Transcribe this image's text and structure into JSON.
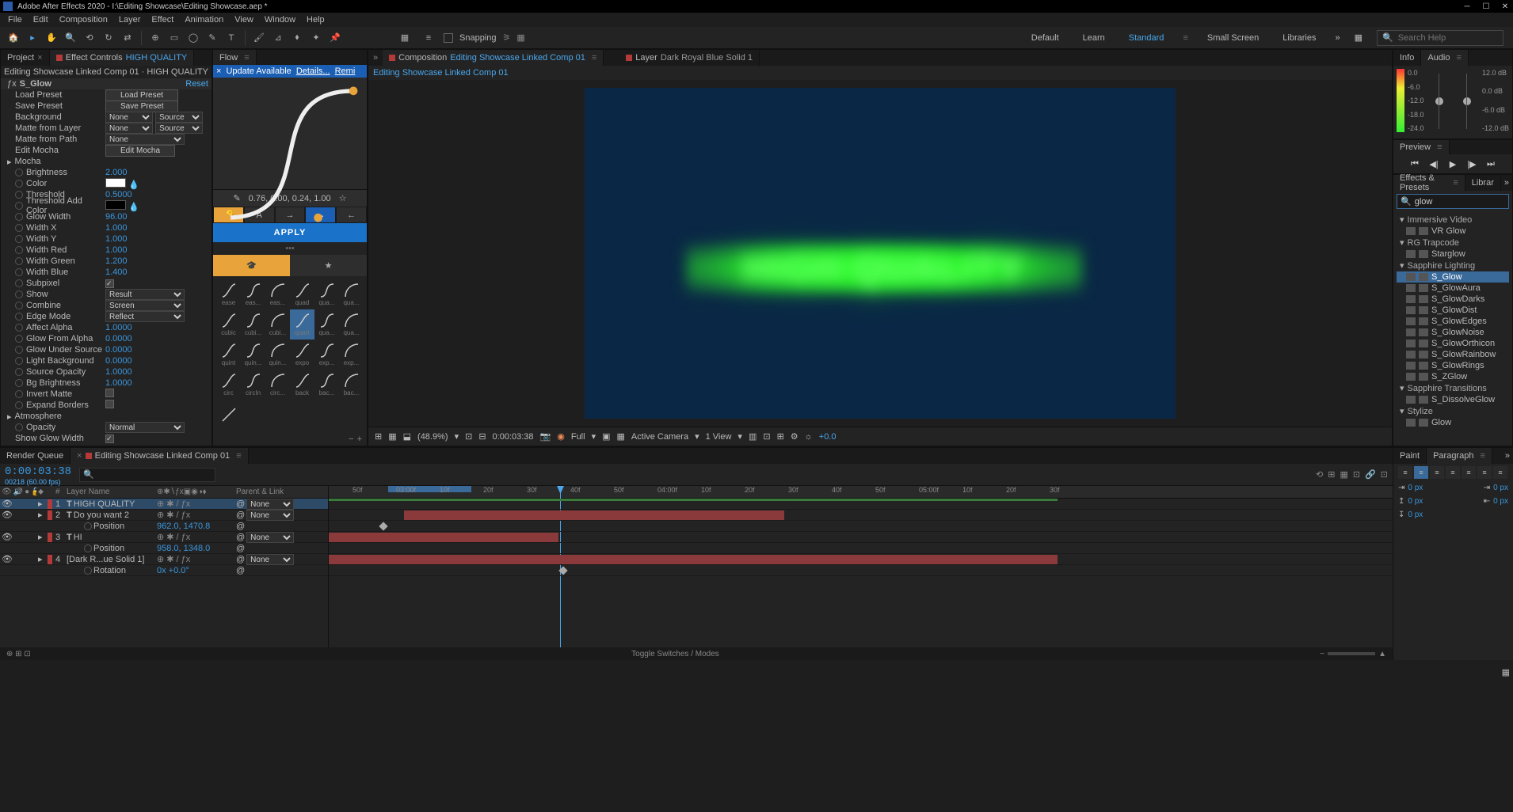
{
  "title": "Adobe After Effects 2020 - I:\\Editing Showcase\\Editing Showcase.aep *",
  "menu": [
    "File",
    "Edit",
    "Composition",
    "Layer",
    "Effect",
    "Animation",
    "View",
    "Window",
    "Help"
  ],
  "toolbar": {
    "snapping_label": "Snapping"
  },
  "workspaces": [
    "Default",
    "Learn",
    "Standard",
    "Small Screen",
    "Libraries"
  ],
  "workspace_active": "Standard",
  "search_placeholder": "Search Help",
  "leftPanel": {
    "tabs": [
      "Project",
      "Effect Controls"
    ],
    "active_effect_layer": "HIGH QUALITY",
    "breadcrumb": "Editing Showcase Linked Comp 01 · HIGH QUALITY",
    "effect_name": "S_Glow",
    "reset": "Reset",
    "props": [
      {
        "label": "Load Preset",
        "type": "btn",
        "btn": "Load Preset"
      },
      {
        "label": "Save Preset",
        "type": "btn",
        "btn": "Save Preset"
      },
      {
        "label": "Background",
        "type": "sel2",
        "v1": "None",
        "v2": "Source"
      },
      {
        "label": "Matte from Layer",
        "type": "sel2",
        "v1": "None",
        "v2": "Source"
      },
      {
        "label": "Matte from Path",
        "type": "sel",
        "v": "None"
      },
      {
        "label": "Edit Mocha",
        "type": "btn",
        "btn": "Edit Mocha"
      },
      {
        "label": "Mocha",
        "type": "group"
      },
      {
        "label": "Brightness",
        "type": "num",
        "v": "2.000",
        "sw": true
      },
      {
        "label": "Color",
        "type": "color",
        "v": "white",
        "sw": true
      },
      {
        "label": "Threshold",
        "type": "num",
        "v": "0.5000",
        "sw": true
      },
      {
        "label": "Threshold Add Color",
        "type": "color",
        "v": "black",
        "sw": true
      },
      {
        "label": "Glow Width",
        "type": "num",
        "v": "96.00",
        "sw": true
      },
      {
        "label": "Width X",
        "type": "num",
        "v": "1.000",
        "sw": true
      },
      {
        "label": "Width Y",
        "type": "num",
        "v": "1.000",
        "sw": true
      },
      {
        "label": "Width Red",
        "type": "num",
        "v": "1.000",
        "sw": true
      },
      {
        "label": "Width Green",
        "type": "num",
        "v": "1.200",
        "sw": true
      },
      {
        "label": "Width Blue",
        "type": "num",
        "v": "1.400",
        "sw": true
      },
      {
        "label": "Subpixel",
        "type": "check",
        "v": true,
        "sw": true
      },
      {
        "label": "Show",
        "type": "selw",
        "v": "Result",
        "sw": true
      },
      {
        "label": "Combine",
        "type": "selw",
        "v": "Screen",
        "sw": true
      },
      {
        "label": "Edge Mode",
        "type": "selw",
        "v": "Reflect",
        "sw": true
      },
      {
        "label": "Affect Alpha",
        "type": "num",
        "v": "1.0000",
        "sw": true
      },
      {
        "label": "Glow From Alpha",
        "type": "num",
        "v": "0.0000",
        "sw": true
      },
      {
        "label": "Glow Under Source",
        "type": "num",
        "v": "0.0000",
        "sw": true
      },
      {
        "label": "Light Background",
        "type": "num",
        "v": "0.0000",
        "sw": true
      },
      {
        "label": "Source Opacity",
        "type": "num",
        "v": "1.0000",
        "sw": true
      },
      {
        "label": "Bg Brightness",
        "type": "num",
        "v": "1.0000",
        "sw": true
      },
      {
        "label": "Invert Matte",
        "type": "check",
        "v": false,
        "sw": true
      },
      {
        "label": "Expand Borders",
        "type": "check",
        "v": false,
        "sw": true
      },
      {
        "label": "Atmosphere",
        "type": "group"
      },
      {
        "label": "Opacity",
        "type": "selw",
        "v": "Normal",
        "sw": true
      },
      {
        "label": "Show Glow Width",
        "type": "check",
        "v": true
      }
    ]
  },
  "flow": {
    "tab": "Flow",
    "notice": [
      "Update Available",
      "Details...",
      "Remi"
    ],
    "coords": "0.76, 0.00, 0.24, 1.00",
    "apply": "APPLY",
    "eases": [
      "ease",
      "eas...",
      "eas...",
      "quad",
      "qua...",
      "qua...",
      "cubic",
      "cubi...",
      "cubi...",
      "quart",
      "qua...",
      "qua...",
      "quint",
      "quin...",
      "quin...",
      "expo",
      "exp...",
      "exp...",
      "circ",
      "circIn",
      "circ...",
      "back",
      "bac...",
      "bac..."
    ]
  },
  "composition": {
    "tabs": [
      {
        "label": "Composition",
        "link": "Editing Showcase Linked Comp 01"
      },
      {
        "label": "Layer",
        "link": "Dark Royal Blue Solid 1"
      }
    ],
    "subtab": "Editing Showcase Linked Comp 01",
    "preview_text": "HIGH QUALITY",
    "footer": {
      "zoom": "(48.9%)",
      "time": "0:00:03:38",
      "res": "Full",
      "camera": "Active Camera",
      "views": "1 View",
      "exposure": "+0.0"
    }
  },
  "info": {
    "tabs": [
      "Info",
      "Audio"
    ],
    "db_left": [
      "0.0",
      "-6.0",
      "-12.0",
      "-18.0",
      "-24.0"
    ],
    "db_right": [
      "12.0 dB",
      "0.0 dB",
      "-6.0 dB",
      "-12.0 dB"
    ]
  },
  "preview": {
    "tab": "Preview"
  },
  "presets": {
    "tabs": [
      "Effects & Presets",
      "Librar"
    ],
    "search": "glow",
    "cats": [
      {
        "name": "Immersive Video",
        "items": [
          "VR Glow"
        ]
      },
      {
        "name": "RG Trapcode",
        "items": [
          "Starglow"
        ]
      },
      {
        "name": "Sapphire Lighting",
        "items": [
          "S_Glow",
          "S_GlowAura",
          "S_GlowDarks",
          "S_GlowDist",
          "S_GlowEdges",
          "S_GlowNoise",
          "S_GlowOrthicon",
          "S_GlowRainbow",
          "S_GlowRings",
          "S_ZGlow"
        ]
      },
      {
        "name": "Sapphire Transitions",
        "items": [
          "S_DissolveGlow"
        ]
      },
      {
        "name": "Stylize",
        "items": [
          "Glow"
        ]
      }
    ],
    "selected": "S_Glow"
  },
  "timeline": {
    "tabs": [
      "Render Queue",
      "Editing Showcase Linked Comp 01"
    ],
    "time": "0:00:03:38",
    "time_sub": "00218 (60.00 fps)",
    "col_head": {
      "layer": "Layer Name",
      "parent": "Parent & Link"
    },
    "layers": [
      {
        "n": "1",
        "color": "#b43a3a",
        "type": "T",
        "name": "HIGH QUALITY",
        "parent": "None"
      },
      {
        "n": "2",
        "color": "#b43a3a",
        "type": "T",
        "name": "Do you want 2",
        "parent": "None"
      },
      {
        "sub": true,
        "name": "Position",
        "val": "962.0, 1470.8"
      },
      {
        "n": "3",
        "color": "#b43a3a",
        "type": "T",
        "name": "HI",
        "parent": "None"
      },
      {
        "sub": true,
        "name": "Position",
        "val": "958.0, 1348.0"
      },
      {
        "n": "4",
        "color": "#b43a3a",
        "type": "",
        "name": "[Dark R...ue Solid 1]",
        "parent": "None"
      },
      {
        "sub": true,
        "name": "Rotation",
        "val": "0x +0.0°"
      }
    ],
    "ruler": [
      "50f",
      "03:00f",
      "10f",
      "20f",
      "30f",
      "40f",
      "50f",
      "04:00f",
      "10f",
      "20f",
      "30f",
      "40f",
      "50f",
      "05:00f",
      "10f",
      "20f",
      "30f"
    ],
    "footer": "Toggle Switches / Modes"
  },
  "paragraph": {
    "tabs": [
      "Paint",
      "Paragraph"
    ],
    "indent": "0 px"
  }
}
